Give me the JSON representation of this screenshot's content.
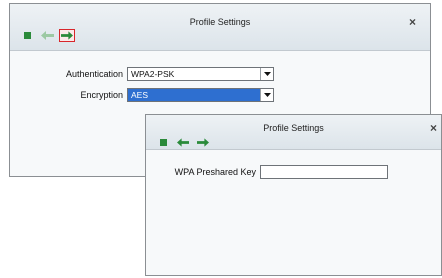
{
  "back_window": {
    "title": "Profile Settings",
    "close_label": "×",
    "fields": {
      "authentication": {
        "label": "Authentication",
        "value": "WPA2-PSK"
      },
      "encryption": {
        "label": "Encryption",
        "value": "AES"
      }
    }
  },
  "front_window": {
    "title": "Profile Settings",
    "close_label": "×",
    "fields": {
      "preshared_key": {
        "label": "WPA Preshared Key",
        "value": ""
      }
    }
  },
  "colors": {
    "accent_green": "#2a8a3a",
    "highlight_red": "#d8262b",
    "selection_blue": "#2e6fd0"
  },
  "icons": [
    "stop-icon",
    "back-arrow-icon",
    "forward-arrow-icon",
    "dropdown-arrow-icon",
    "close-icon"
  ]
}
